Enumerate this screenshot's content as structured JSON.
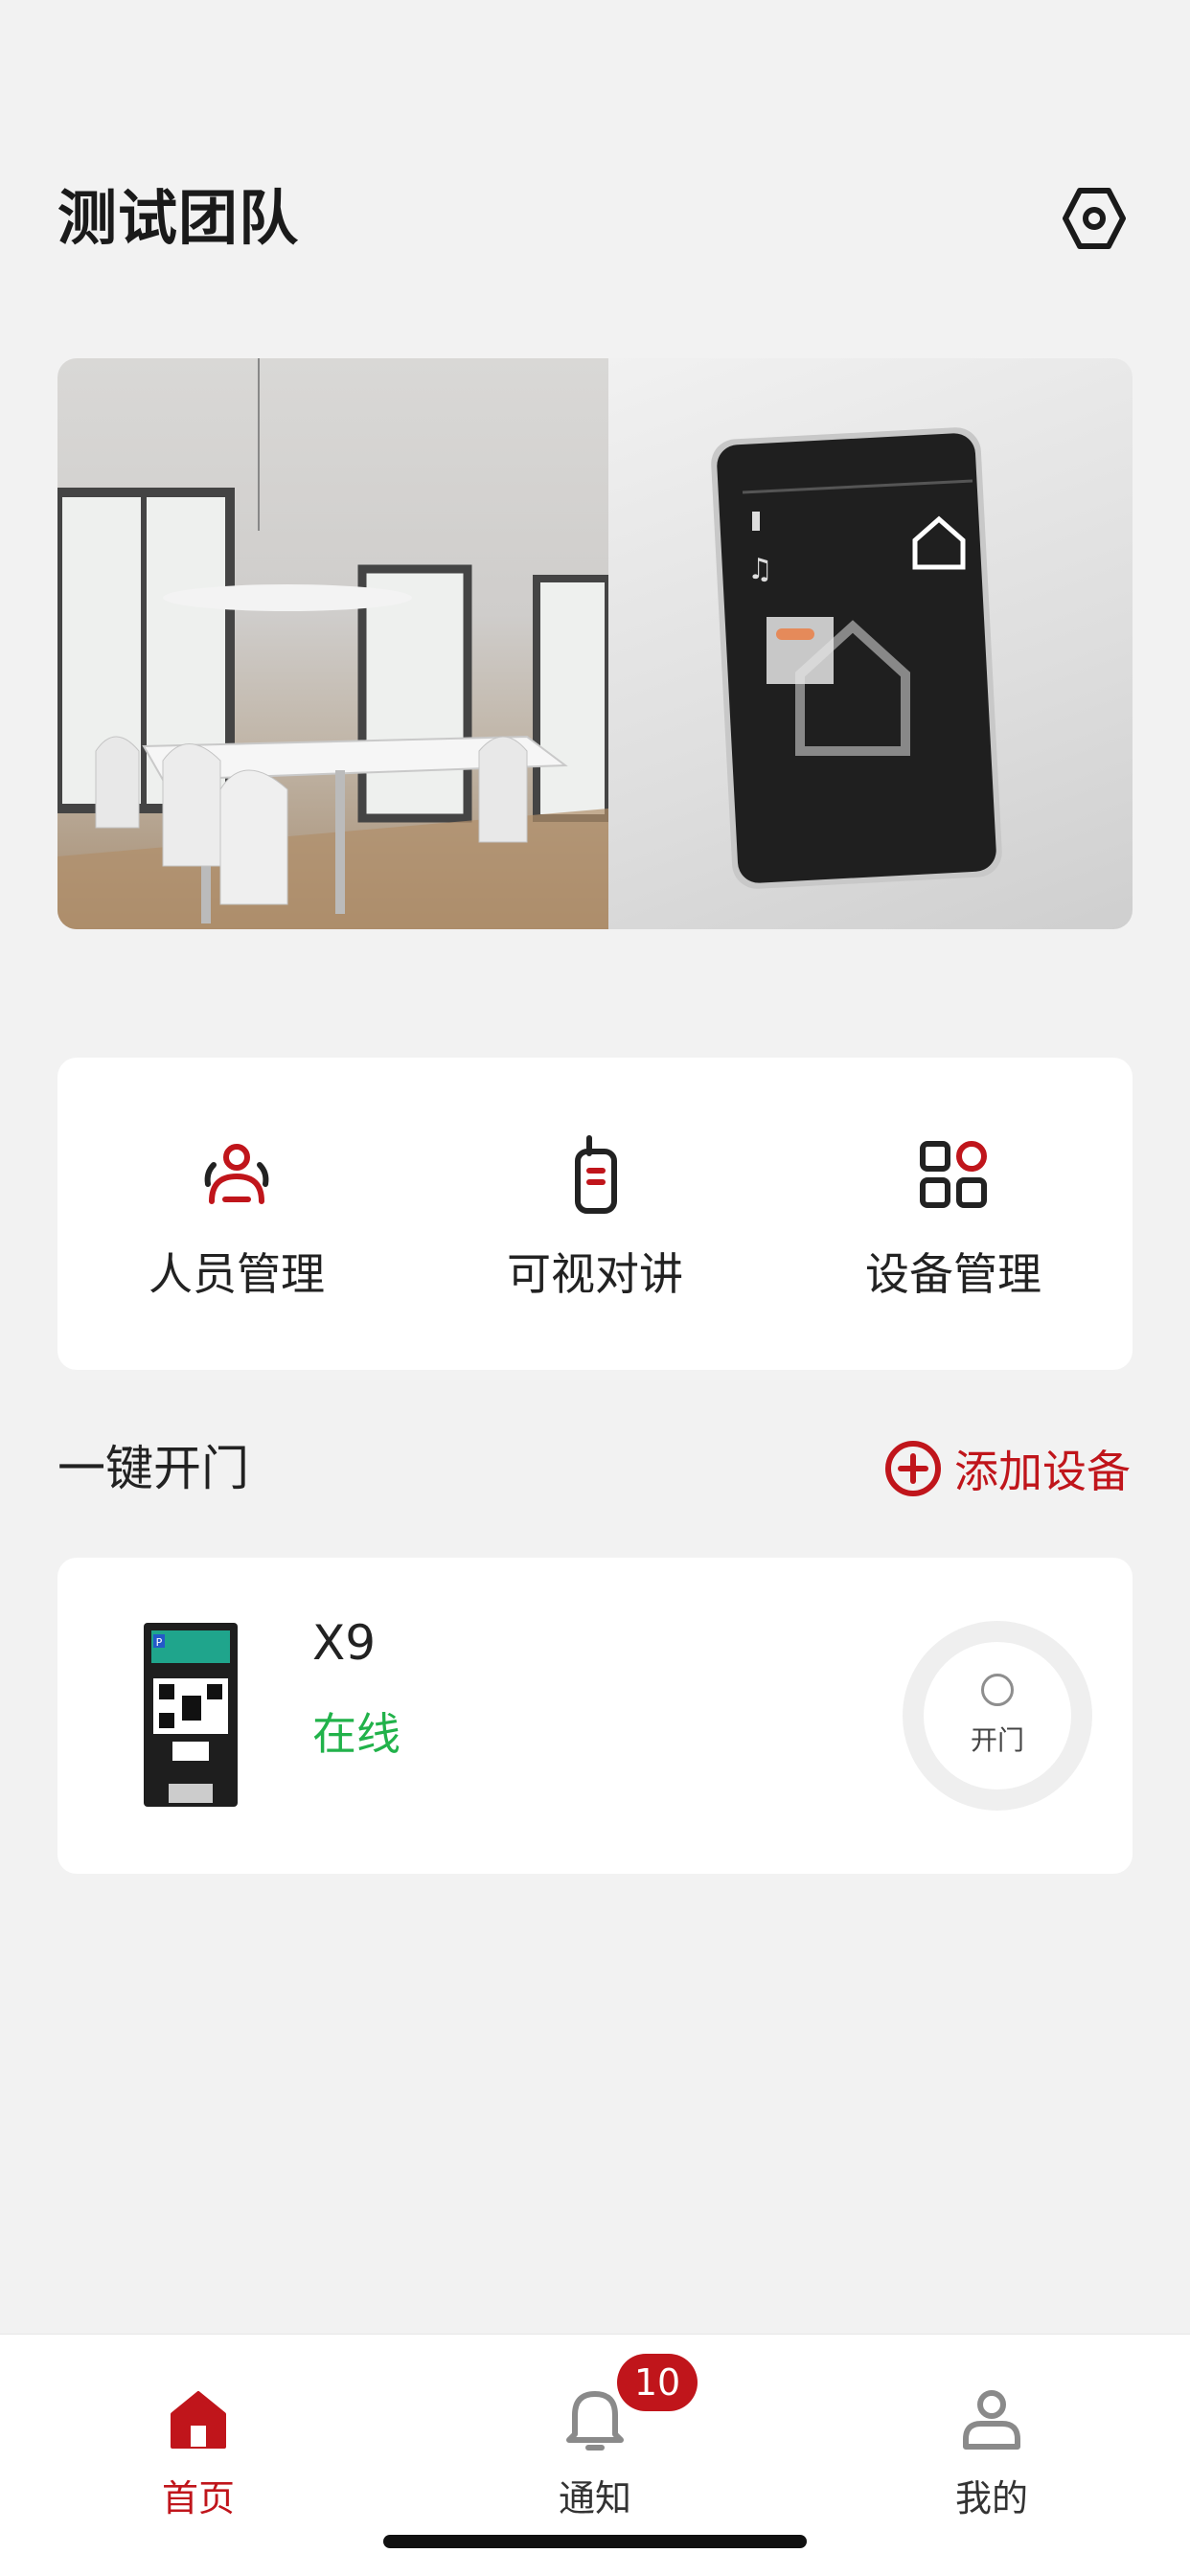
{
  "header": {
    "title": "测试团队"
  },
  "quick_actions": [
    {
      "label": "人员管理",
      "icon": "people-icon"
    },
    {
      "label": "可视对讲",
      "icon": "walkie-talkie-icon"
    },
    {
      "label": "设备管理",
      "icon": "grid-apps-icon"
    }
  ],
  "section": {
    "title": "一键开门",
    "add_label": "添加设备"
  },
  "device": {
    "name": "X9",
    "status": "在线",
    "open_label": "开门",
    "thumb_screen_text": "P"
  },
  "tabbar": {
    "tabs": [
      {
        "label": "首页",
        "icon": "home-icon",
        "active": true
      },
      {
        "label": "通知",
        "icon": "bell-icon",
        "badge": "10"
      },
      {
        "label": "我的",
        "icon": "person-icon"
      }
    ]
  },
  "colors": {
    "accent": "#c0151b",
    "online": "#21b24a",
    "background": "#f2f2f2"
  }
}
